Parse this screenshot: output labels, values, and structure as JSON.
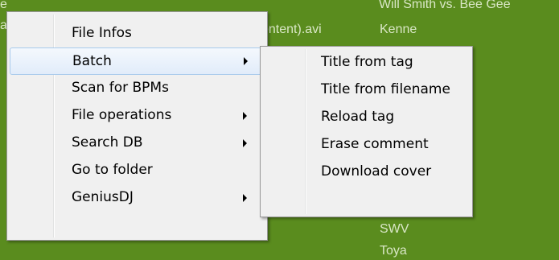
{
  "background_list": {
    "items": [
      {
        "text": "e"
      },
      {
        "text": "a"
      },
      {
        "text": "Will Smith vs. Bee Gee"
      },
      {
        "text": "ontent).avi"
      },
      {
        "text": "Kenne"
      },
      {
        "text": "SWV"
      },
      {
        "text": "Toya"
      }
    ]
  },
  "context_menu": {
    "items": [
      {
        "label": "File Infos",
        "has_submenu": false
      },
      {
        "label": "Batch",
        "has_submenu": true,
        "highlighted": true
      },
      {
        "label": "Scan for BPMs",
        "has_submenu": false
      },
      {
        "label": "File operations",
        "has_submenu": true
      },
      {
        "label": "Search DB",
        "has_submenu": true
      },
      {
        "label": "Go to folder",
        "has_submenu": false
      },
      {
        "label": "GeniusDJ",
        "has_submenu": true
      }
    ]
  },
  "batch_submenu": {
    "items": [
      {
        "label": "Title from tag"
      },
      {
        "label": "Title from filename"
      },
      {
        "label": "Reload tag"
      },
      {
        "label": "Erase comment"
      },
      {
        "label": "Download cover"
      }
    ]
  },
  "colors": {
    "background_green": "#5A8C1E",
    "menu_background": "#F0F0F0",
    "highlight_border": "#A8CAEC"
  },
  "icons": {
    "submenu_arrow": "chevron-right-icon"
  }
}
